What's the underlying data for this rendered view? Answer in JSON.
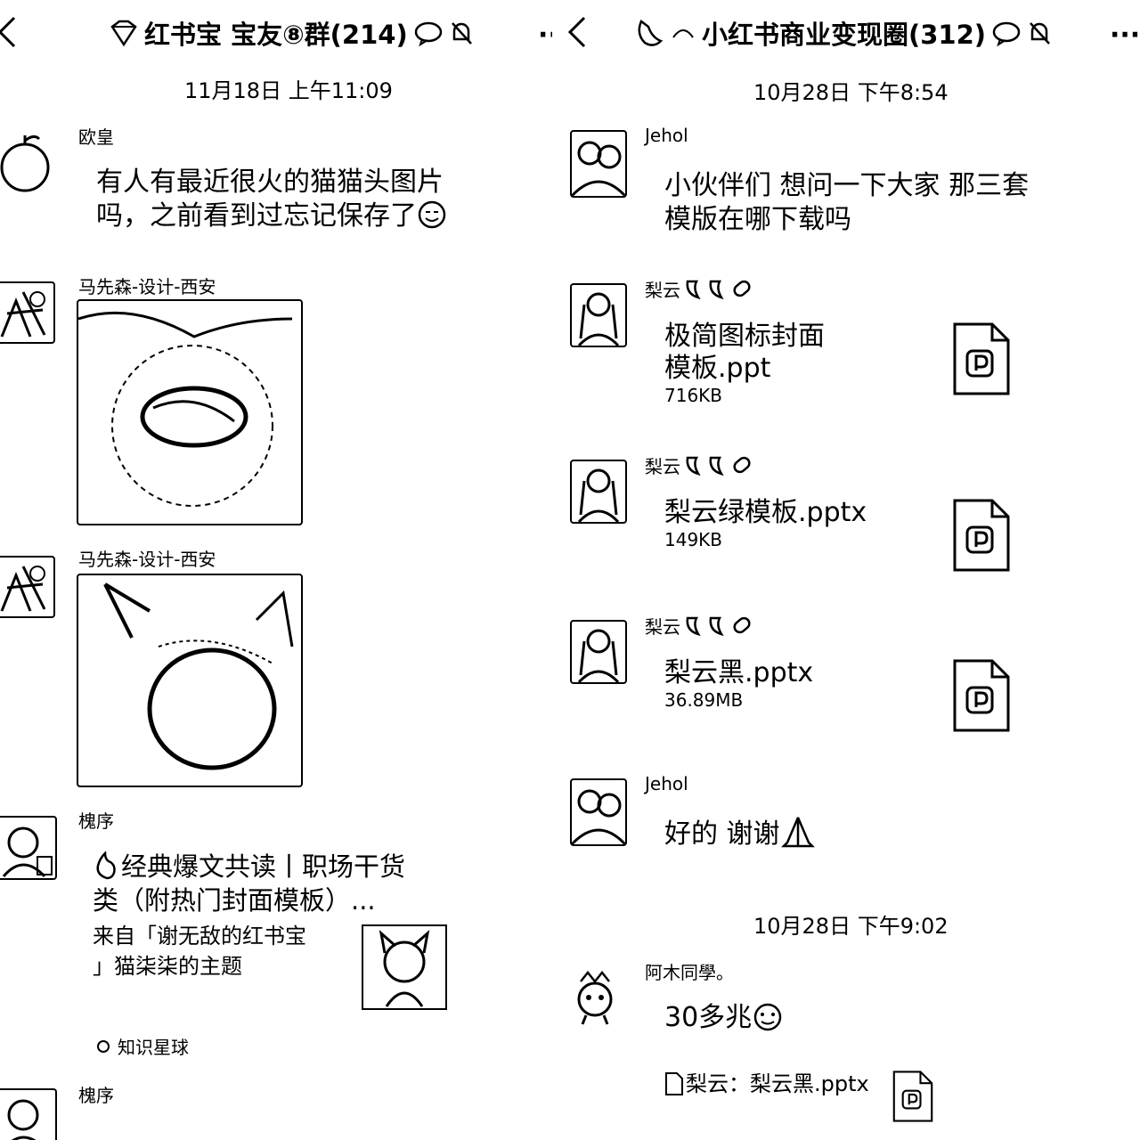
{
  "left": {
    "header": {
      "back_icon": "chevron-left-icon",
      "title": "红书宝 宝友⑧群(214)",
      "more": "···"
    },
    "timestamp": "11月18日 上午11:09",
    "messages": [
      {
        "sender": "欧皇",
        "text_line1": "有人有最近很火的猫猫头图片",
        "text_line2": "吗，之前看到过忘记保存了"
      },
      {
        "sender": "马先森-设计-西安"
      },
      {
        "sender": "马先森-设计-西安"
      },
      {
        "sender": "槐序",
        "card_title_line1": "经典爆文共读丨职场干货",
        "card_title_line2": "类（附热门封面模板）...",
        "card_source_line1": "来自「谢无敌的红书宝",
        "card_source_line2": "」猫柒柒的主题",
        "card_footer": "知识星球"
      },
      {
        "sender": "槐序"
      }
    ]
  },
  "right": {
    "header": {
      "back_icon": "chevron-left-icon",
      "title": "小红书商业变现圈(312)",
      "more": "···"
    },
    "timestamp1": "10月28日 下午8:54",
    "timestamp2": "10月28日 下午9:02",
    "messages": [
      {
        "sender": "Jehol",
        "text_line1": "小伙伴们 想问一下大家 那三套",
        "text_line2": "模版在哪下载吗"
      },
      {
        "sender": "梨云",
        "file_line1": "极简图标封面",
        "file_line2": "模板.ppt",
        "size": "716KB"
      },
      {
        "sender": "梨云",
        "file": "梨云绿模板.pptx",
        "size": "149KB"
      },
      {
        "sender": "梨云",
        "file": "梨云黑.pptx",
        "size": "36.89MB"
      },
      {
        "sender": "Jehol",
        "text": "好的 谢谢"
      },
      {
        "sender": "阿木同學。",
        "text": "30多兆",
        "quote": "梨云：梨云黑.pptx"
      }
    ]
  }
}
